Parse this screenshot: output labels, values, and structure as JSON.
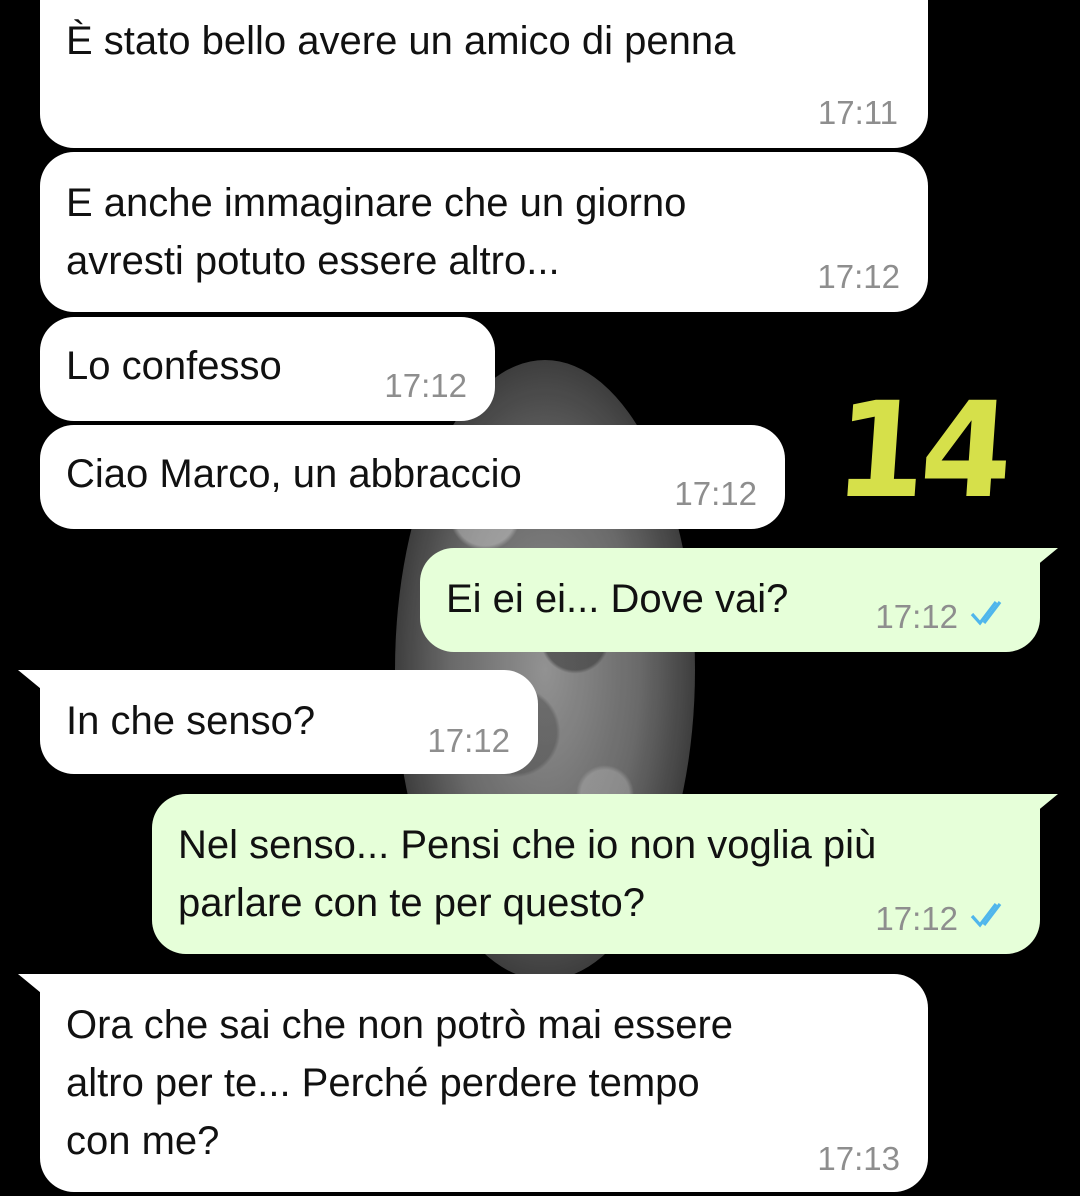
{
  "messages": [
    {
      "direction": "in",
      "text": "È stato bello avere un amico di penna",
      "time": "17:11"
    },
    {
      "direction": "in",
      "text": "E anche immaginare che un giorno\navresti potuto essere altro...",
      "time": "17:12"
    },
    {
      "direction": "in",
      "text": "Lo confesso",
      "time": "17:12"
    },
    {
      "direction": "in",
      "text": "Ciao Marco, un abbraccio",
      "time": "17:12"
    },
    {
      "direction": "out",
      "text": "Ei ei ei... Dove vai?",
      "time": "17:12",
      "status": "read"
    },
    {
      "direction": "in",
      "text": "In che senso?",
      "time": "17:12"
    },
    {
      "direction": "out",
      "text": "Nel senso... Pensi che io non voglia più\nparlare con te per questo?",
      "time": "17:12",
      "status": "read"
    },
    {
      "direction": "in",
      "text": "Ora che sai che non potrò mai essere\naltro per te... Perché perdere tempo\ncon me?",
      "time": "17:13"
    }
  ],
  "overlay_number": "14",
  "colors": {
    "background": "#000000",
    "incoming_bubble": "#ffffff",
    "outgoing_bubble": "#e6ffd9",
    "read_ticks": "#4fb6ec",
    "overlay_number": "#d6e04a"
  },
  "icons": {
    "read_status": "double-check-icon",
    "background_image": "moon-image"
  }
}
